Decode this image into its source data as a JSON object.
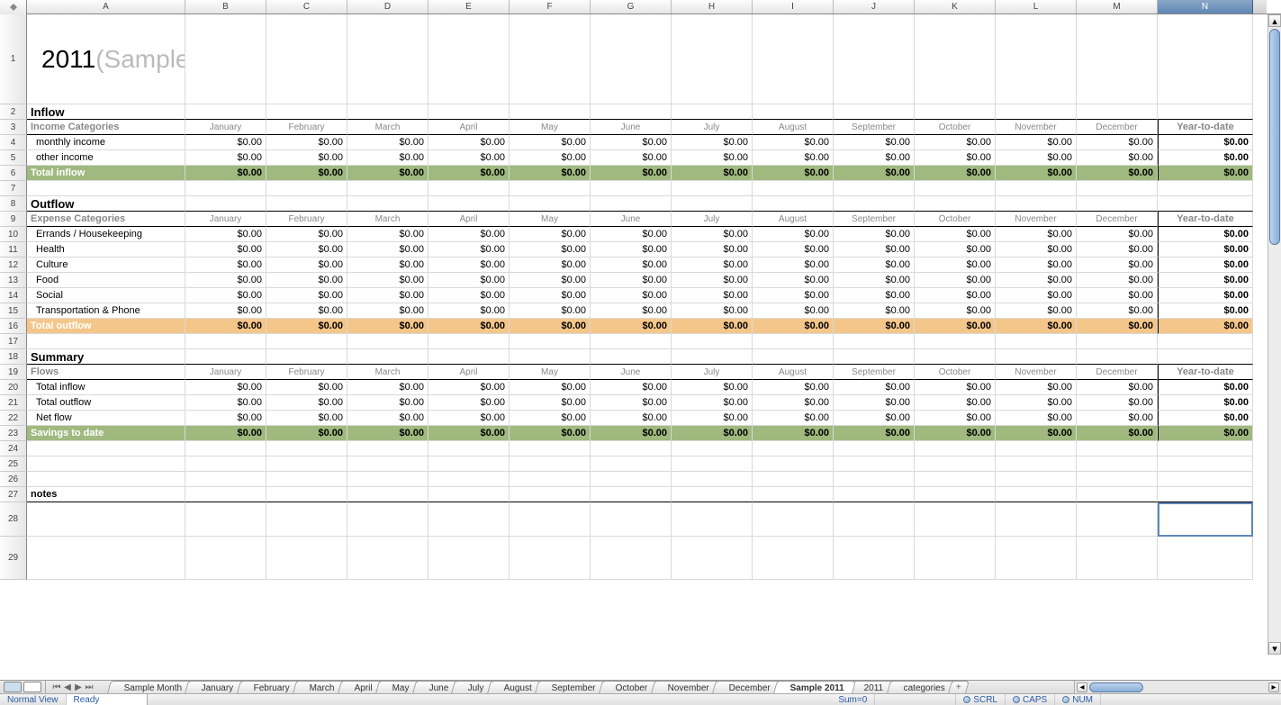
{
  "columns": [
    "A",
    "B",
    "C",
    "D",
    "E",
    "F",
    "G",
    "H",
    "I",
    "J",
    "K",
    "L",
    "M",
    "N"
  ],
  "months": [
    "January",
    "February",
    "March",
    "April",
    "May",
    "June",
    "July",
    "August",
    "September",
    "October",
    "November",
    "December"
  ],
  "ytd_label": "Year-to-date",
  "title_year": "2011",
  "title_sample": "(Sample)",
  "sections": {
    "inflow": {
      "heading": "Inflow",
      "cat_label": "Income Categories",
      "rows": [
        {
          "label": "monthly income",
          "values": [
            "$0.00",
            "$0.00",
            "$0.00",
            "$0.00",
            "$0.00",
            "$0.00",
            "$0.00",
            "$0.00",
            "$0.00",
            "$0.00",
            "$0.00",
            "$0.00"
          ],
          "ytd": "$0.00"
        },
        {
          "label": "other income",
          "values": [
            "$0.00",
            "$0.00",
            "$0.00",
            "$0.00",
            "$0.00",
            "$0.00",
            "$0.00",
            "$0.00",
            "$0.00",
            "$0.00",
            "$0.00",
            "$0.00"
          ],
          "ytd": "$0.00"
        }
      ],
      "total": {
        "label": "Total inflow",
        "values": [
          "$0.00",
          "$0.00",
          "$0.00",
          "$0.00",
          "$0.00",
          "$0.00",
          "$0.00",
          "$0.00",
          "$0.00",
          "$0.00",
          "$0.00",
          "$0.00"
        ],
        "ytd": "$0.00"
      }
    },
    "outflow": {
      "heading": "Outflow",
      "cat_label": "Expense Categories",
      "rows": [
        {
          "label": "Errands / Housekeeping",
          "values": [
            "$0.00",
            "$0.00",
            "$0.00",
            "$0.00",
            "$0.00",
            "$0.00",
            "$0.00",
            "$0.00",
            "$0.00",
            "$0.00",
            "$0.00",
            "$0.00"
          ],
          "ytd": "$0.00"
        },
        {
          "label": "Health",
          "values": [
            "$0.00",
            "$0.00",
            "$0.00",
            "$0.00",
            "$0.00",
            "$0.00",
            "$0.00",
            "$0.00",
            "$0.00",
            "$0.00",
            "$0.00",
            "$0.00"
          ],
          "ytd": "$0.00"
        },
        {
          "label": "Culture",
          "values": [
            "$0.00",
            "$0.00",
            "$0.00",
            "$0.00",
            "$0.00",
            "$0.00",
            "$0.00",
            "$0.00",
            "$0.00",
            "$0.00",
            "$0.00",
            "$0.00"
          ],
          "ytd": "$0.00"
        },
        {
          "label": "Food",
          "values": [
            "$0.00",
            "$0.00",
            "$0.00",
            "$0.00",
            "$0.00",
            "$0.00",
            "$0.00",
            "$0.00",
            "$0.00",
            "$0.00",
            "$0.00",
            "$0.00"
          ],
          "ytd": "$0.00"
        },
        {
          "label": "Social",
          "values": [
            "$0.00",
            "$0.00",
            "$0.00",
            "$0.00",
            "$0.00",
            "$0.00",
            "$0.00",
            "$0.00",
            "$0.00",
            "$0.00",
            "$0.00",
            "$0.00"
          ],
          "ytd": "$0.00"
        },
        {
          "label": "Transportation & Phone",
          "values": [
            "$0.00",
            "$0.00",
            "$0.00",
            "$0.00",
            "$0.00",
            "$0.00",
            "$0.00",
            "$0.00",
            "$0.00",
            "$0.00",
            "$0.00",
            "$0.00"
          ],
          "ytd": "$0.00"
        }
      ],
      "total": {
        "label": "Total outflow",
        "values": [
          "$0.00",
          "$0.00",
          "$0.00",
          "$0.00",
          "$0.00",
          "$0.00",
          "$0.00",
          "$0.00",
          "$0.00",
          "$0.00",
          "$0.00",
          "$0.00"
        ],
        "ytd": "$0.00"
      }
    },
    "summary": {
      "heading": "Summary",
      "cat_label": "Flows",
      "rows": [
        {
          "label": "Total inflow",
          "values": [
            "$0.00",
            "$0.00",
            "$0.00",
            "$0.00",
            "$0.00",
            "$0.00",
            "$0.00",
            "$0.00",
            "$0.00",
            "$0.00",
            "$0.00",
            "$0.00"
          ],
          "ytd": "$0.00"
        },
        {
          "label": "Total outflow",
          "values": [
            "$0.00",
            "$0.00",
            "$0.00",
            "$0.00",
            "$0.00",
            "$0.00",
            "$0.00",
            "$0.00",
            "$0.00",
            "$0.00",
            "$0.00",
            "$0.00"
          ],
          "ytd": "$0.00"
        },
        {
          "label": "Net flow",
          "values": [
            "$0.00",
            "$0.00",
            "$0.00",
            "$0.00",
            "$0.00",
            "$0.00",
            "$0.00",
            "$0.00",
            "$0.00",
            "$0.00",
            "$0.00",
            "$0.00"
          ],
          "ytd": "$0.00"
        }
      ],
      "savings": {
        "label": "Savings to date",
        "values": [
          "$0.00",
          "$0.00",
          "$0.00",
          "$0.00",
          "$0.00",
          "$0.00",
          "$0.00",
          "$0.00",
          "$0.00",
          "$0.00",
          "$0.00",
          "$0.00"
        ],
        "ytd": "$0.00"
      }
    }
  },
  "notes_label": "notes",
  "tabs": [
    "Sample Month",
    "January",
    "February",
    "March",
    "April",
    "May",
    "June",
    "July",
    "August",
    "September",
    "October",
    "November",
    "December",
    "Sample 2011",
    "2011",
    "categories"
  ],
  "active_tab": "Sample 2011",
  "status": {
    "view": "Normal View",
    "ready": "Ready",
    "sum": "Sum=0",
    "scrl": "SCRL",
    "caps": "CAPS",
    "num": "NUM"
  },
  "selected_cell": "N28"
}
